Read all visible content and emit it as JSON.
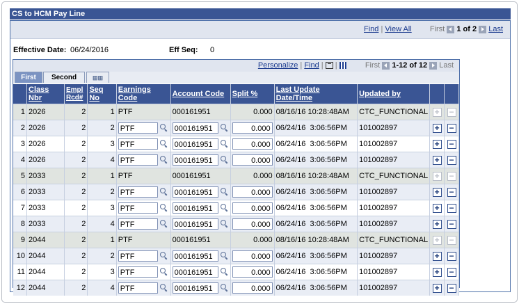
{
  "title": "CS to HCM Pay Line",
  "outer_nav": {
    "find": "Find",
    "view_all": "View All",
    "first": "First",
    "range": "1 of 2",
    "last": "Last"
  },
  "effective": {
    "date_label": "Effective Date:",
    "date_value": "06/24/2016",
    "seq_label": "Eff Seq:",
    "seq_value": "0"
  },
  "inner_nav": {
    "personalize": "Personalize",
    "find": "Find",
    "first": "First",
    "range": "1-12 of 12",
    "last": "Last"
  },
  "tabs": {
    "first": "First",
    "second": "Second"
  },
  "columns": [
    "Class Nbr",
    "Empl Rcd#",
    "Seq No",
    "Earnings Code",
    "Account Code",
    "Split %",
    "Last Update Date/Time",
    "Updated by"
  ],
  "rows": [
    {
      "n": "1",
      "class": "2026",
      "empl": "2",
      "seq": "1",
      "earn": "PTF",
      "acct": "000161951",
      "split": "0.000",
      "updated": "08/16/16 10:28:48AM",
      "by": "CTC_FUNCTIONAL",
      "editable": false
    },
    {
      "n": "2",
      "class": "2026",
      "empl": "2",
      "seq": "2",
      "earn": "PTF",
      "acct": "000161951",
      "split": "0.000",
      "updated": "06/24/16  3:06:56PM",
      "by": "101002897",
      "editable": true
    },
    {
      "n": "3",
      "class": "2026",
      "empl": "2",
      "seq": "3",
      "earn": "PTF",
      "acct": "000161951",
      "split": "0.000",
      "updated": "06/24/16  3:06:56PM",
      "by": "101002897",
      "editable": true
    },
    {
      "n": "4",
      "class": "2026",
      "empl": "2",
      "seq": "4",
      "earn": "PTF",
      "acct": "000161951",
      "split": "0.000",
      "updated": "06/24/16  3:06:56PM",
      "by": "101002897",
      "editable": true
    },
    {
      "n": "5",
      "class": "2033",
      "empl": "2",
      "seq": "1",
      "earn": "PTF",
      "acct": "000161951",
      "split": "0.000",
      "updated": "08/16/16 10:28:48AM",
      "by": "CTC_FUNCTIONAL",
      "editable": false
    },
    {
      "n": "6",
      "class": "2033",
      "empl": "2",
      "seq": "2",
      "earn": "PTF",
      "acct": "000161951",
      "split": "0.000",
      "updated": "06/24/16  3:06:56PM",
      "by": "101002897",
      "editable": true
    },
    {
      "n": "7",
      "class": "2033",
      "empl": "2",
      "seq": "3",
      "earn": "PTF",
      "acct": "000161951",
      "split": "0.000",
      "updated": "06/24/16  3:06:56PM",
      "by": "101002897",
      "editable": true
    },
    {
      "n": "8",
      "class": "2033",
      "empl": "2",
      "seq": "4",
      "earn": "PTF",
      "acct": "000161951",
      "split": "0.000",
      "updated": "06/24/16  3:06:56PM",
      "by": "101002897",
      "editable": true
    },
    {
      "n": "9",
      "class": "2044",
      "empl": "2",
      "seq": "1",
      "earn": "PTF",
      "acct": "000161951",
      "split": "0.000",
      "updated": "08/16/16 10:28:48AM",
      "by": "CTC_FUNCTIONAL",
      "editable": false
    },
    {
      "n": "10",
      "class": "2044",
      "empl": "2",
      "seq": "2",
      "earn": "PTF",
      "acct": "000161951",
      "split": "0.000",
      "updated": "06/24/16  3:06:56PM",
      "by": "101002897",
      "editable": true
    },
    {
      "n": "11",
      "class": "2044",
      "empl": "2",
      "seq": "3",
      "earn": "PTF",
      "acct": "000161951",
      "split": "0.000",
      "updated": "06/24/16  3:06:56PM",
      "by": "101002897",
      "editable": true
    },
    {
      "n": "12",
      "class": "2044",
      "empl": "2",
      "seq": "4",
      "earn": "PTF",
      "acct": "000161951",
      "split": "0.000",
      "updated": "06/24/16  3:06:56PM",
      "by": "101002897",
      "editable": true
    }
  ],
  "row_buttons": {
    "add": "+",
    "delete": "−"
  },
  "colors": {
    "header_bg": "#3a5594",
    "nav_bg": "#e0e5ef",
    "alt_row": "#e9edf5",
    "readonly_row": "#e0e4e0",
    "link": "#1a3a8e"
  }
}
